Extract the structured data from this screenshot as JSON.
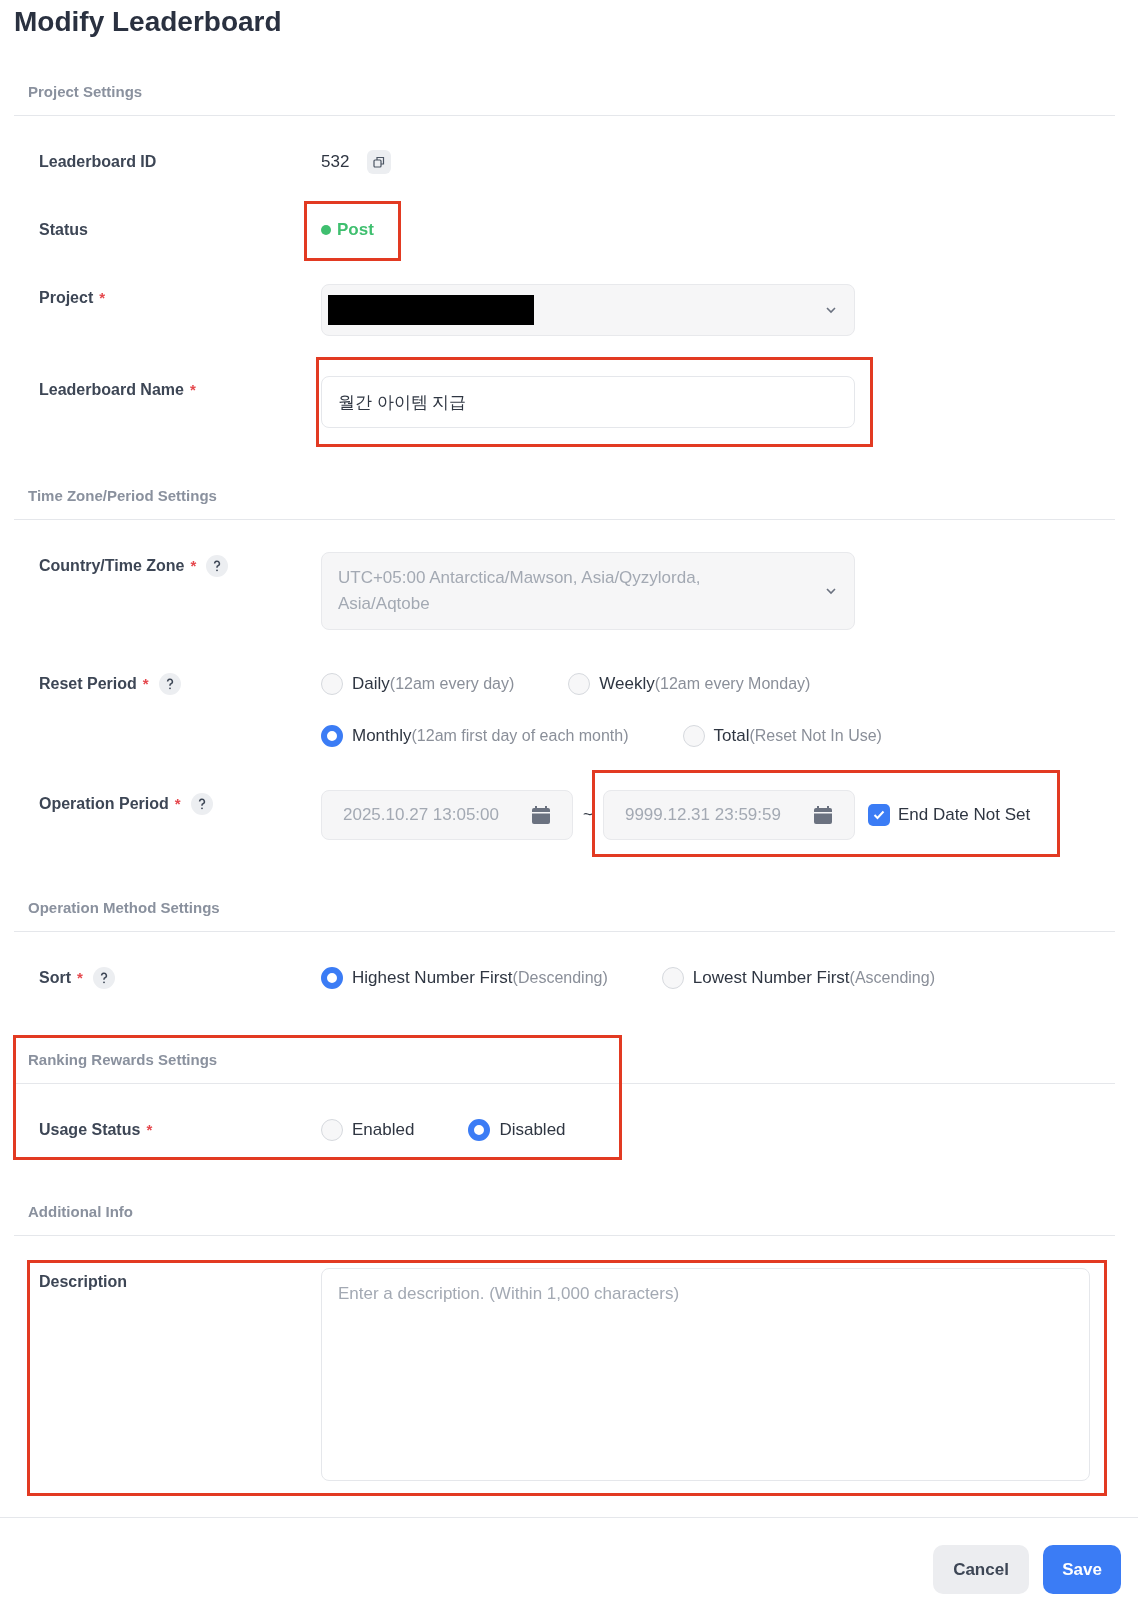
{
  "title": "Modify Leaderboard",
  "sections": [
    {
      "title": "Project Settings",
      "highlighted": false,
      "fields": [
        {
          "kind": "text",
          "label": "Leaderboard ID",
          "value": "532",
          "copy_button": true
        },
        {
          "kind": "status",
          "label": "Status",
          "value": "Post",
          "color": "#3fbf6f",
          "highlighted": true
        },
        {
          "kind": "select",
          "label": "Project",
          "required_mark": "*",
          "redacted": true
        },
        {
          "kind": "input",
          "label": "Leaderboard Name",
          "required_mark": "*",
          "value": "월간 아이템 지급",
          "highlighted": true
        }
      ]
    },
    {
      "title": "Time Zone/Period Settings",
      "highlighted": false,
      "fields": [
        {
          "kind": "select",
          "label": "Country/Time Zone",
          "required_mark": "*",
          "help": true,
          "value": "UTC+05:00 Antarctica/Mawson, Asia/Qyzylorda, Asia/Aqtobe",
          "disabled": true
        },
        {
          "kind": "radio",
          "label": "Reset Period",
          "required_mark": "*",
          "help": true,
          "options": [
            {
              "label": "Daily",
              "hint": "(12am every day)",
              "selected": false
            },
            {
              "label": "Weekly",
              "hint": "(12am every Monday)",
              "selected": false
            },
            {
              "label": "Monthly",
              "hint": "(12am first day of each month)",
              "selected": true
            },
            {
              "label": "Total",
              "hint": "(Reset Not In Use)",
              "selected": false
            }
          ]
        },
        {
          "kind": "daterange",
          "label": "Operation Period",
          "required_mark": "*",
          "help": true,
          "start": "2025.10.27 13:05:00",
          "separator": "~",
          "end": "9999.12.31 23:59:59",
          "highlighted": true,
          "checkbox": {
            "label": "End Date Not Set",
            "checked": true
          }
        }
      ]
    },
    {
      "title": "Operation Method Settings",
      "highlighted": false,
      "fields": [
        {
          "kind": "radio",
          "label": "Sort",
          "required_mark": "*",
          "help": true,
          "options": [
            {
              "label": "Highest Number First",
              "hint": "(Descending)",
              "selected": true
            },
            {
              "label": "Lowest Number First",
              "hint": "(Ascending)",
              "selected": false
            }
          ]
        }
      ]
    },
    {
      "title": "Ranking Rewards Settings",
      "highlighted": true,
      "fields": [
        {
          "kind": "radio",
          "label": "Usage Status",
          "required_mark": "*",
          "options": [
            {
              "label": "Enabled",
              "selected": false
            },
            {
              "label": "Disabled",
              "selected": true
            }
          ]
        }
      ]
    },
    {
      "title": "Additional Info",
      "highlighted": false,
      "fields": [
        {
          "kind": "textarea",
          "label": "Description",
          "placeholder": "Enter a description. (Within 1,000 characters)",
          "highlighted": true
        }
      ]
    }
  ],
  "buttons": [
    {
      "label": "Cancel",
      "kind": "secondary"
    },
    {
      "label": "Save",
      "kind": "primary"
    }
  ]
}
